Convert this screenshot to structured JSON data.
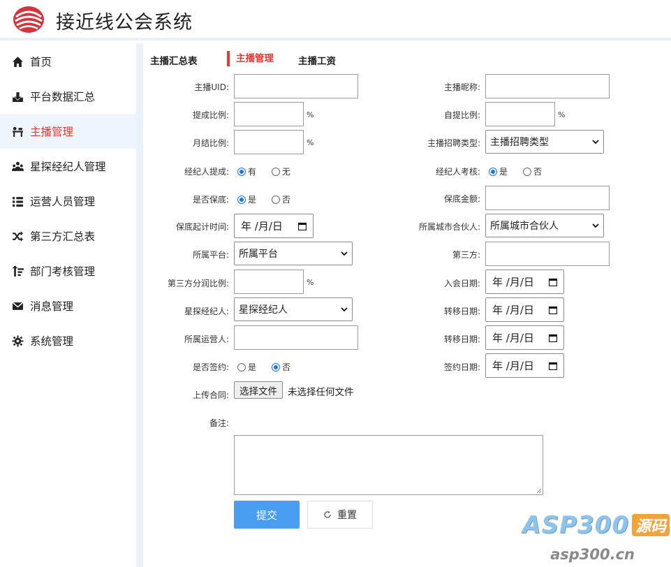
{
  "app": {
    "title": "接近线公会系统",
    "brand_color": "#d6343b"
  },
  "sidebar": {
    "items": [
      {
        "label": "首页",
        "icon": "home-icon"
      },
      {
        "label": "平台数据汇总",
        "icon": "chart-download-icon"
      },
      {
        "label": "主播管理",
        "icon": "anchor-desk-icon",
        "active": true
      },
      {
        "label": "星探经纪人管理",
        "icon": "users-icon"
      },
      {
        "label": "运营人员管理",
        "icon": "list-icon"
      },
      {
        "label": "第三方汇总表",
        "icon": "shuffle-icon"
      },
      {
        "label": "部门考核管理",
        "icon": "sort-icon"
      },
      {
        "label": "消息管理",
        "icon": "envelope-icon"
      },
      {
        "label": "系统管理",
        "icon": "gear-icon"
      }
    ]
  },
  "tabs": [
    {
      "label": "主播汇总表"
    },
    {
      "label": "主播管理",
      "active": true
    },
    {
      "label": "主播工资"
    }
  ],
  "form": {
    "uid_label": "主播UID:",
    "nickname_label": "主播昵称:",
    "commission_label": "提成比例:",
    "self_commission_label": "自提比例:",
    "monthly_label": "月结比例:",
    "recruit_type_label": "主播招聘类型:",
    "recruit_type_value": "主播招聘类型",
    "agent_commission_label": "经纪人提成:",
    "agent_commission_options": [
      "有",
      "无"
    ],
    "agent_commission_selected": "有",
    "agent_review_label": "经纪人考核:",
    "agent_review_options": [
      "是",
      "否"
    ],
    "agent_review_selected": "是",
    "guarantee_label": "是否保底:",
    "guarantee_options": [
      "是",
      "否"
    ],
    "guarantee_selected": "是",
    "guarantee_amount_label": "保底金额:",
    "guarantee_start_label": "保底起计时间:",
    "city_partner_label": "所属城市合伙人:",
    "city_partner_value": "所属城市合伙人",
    "platform_label": "所属平台:",
    "platform_value": "所属平台",
    "third_party_label": "第三方:",
    "third_party_share_label": "第三方分润比例:",
    "join_date_label": "入会日期:",
    "scout_label": "星探经纪人:",
    "scout_value": "星探经纪人",
    "transfer_date_label": "转移日期:",
    "operator_label": "所属运营人:",
    "transfer_date2_label": "转移日期:",
    "signed_label": "是否签约:",
    "signed_options": [
      "是",
      "否"
    ],
    "signed_selected": "否",
    "sign_date_label": "签约日期:",
    "upload_label": "上传合同:",
    "upload_button": "选择文件",
    "upload_status": "未选择任何文件",
    "remark_label": "备注:",
    "percent": "%",
    "date_placeholder": "年 /月/日",
    "submit": "提交",
    "reset": "重置"
  },
  "watermark": {
    "brand": "ASP300",
    "badge": "源码",
    "url": "asp300.cn"
  }
}
